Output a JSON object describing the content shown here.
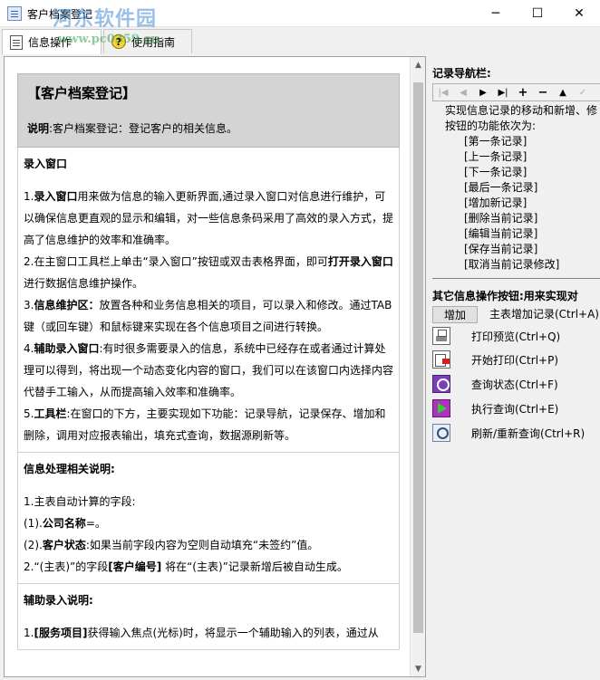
{
  "window": {
    "title": "客户档案登记",
    "watermark": "河东软件园",
    "watermark_url": "www.pc0359.cn",
    "controls": {
      "minimize": "─",
      "maximize": "☐",
      "close": "✕"
    }
  },
  "tabs": [
    {
      "label": "信息操作",
      "icon": "document-icon",
      "active": true
    },
    {
      "label": "使用指南",
      "icon": "help-icon",
      "active": false
    }
  ],
  "doc": {
    "title": "【客户档案登记】",
    "desc_bold": "说明",
    "desc_text": ":客户档案登记：登记客户的相关信息。",
    "sections": [
      {
        "heading": "录入窗口",
        "paras": [
          {
            "pre": "1.",
            "bold": "录入窗口",
            "text": "用来做为信息的输入更新界面,通过录入窗口对信息进行维护，可以确保信息更直观的显示和编辑，对一些信息条码采用了高效的录入方式，提高了信息维护的效率和准确率。"
          },
          {
            "pre": "2.",
            "bold": "",
            "text": "在主窗口工具栏上单击“录入窗口”按钮或双击表格界面，即可",
            "bold2": "打开录入窗口",
            "text2": "进行数据信息维护操作。"
          },
          {
            "pre": "3.",
            "bold": "信息维护区：",
            "text": "放置各种和业务信息相关的项目，可以录入和修改。通过TAB键（或回车键）和鼠标键来实现在各个信息项目之间进行转换。"
          },
          {
            "pre": "4.",
            "bold": "辅助录入窗口",
            "text": ":有时很多需要录入的信息，系统中已经存在或者通过计算处理可以得到，将出现一个动态变化内容的窗口，我们可以在该窗口内选择内容代替手工输入，从而提高输入效率和准确率。"
          },
          {
            "pre": "5.",
            "bold": "工具栏",
            "text": ":在窗口的下方，主要实现如下功能：记录导航，记录保存、增加和删除，调用对应报表输出，填充式查询，数据源刷新等。"
          }
        ]
      },
      {
        "heading": "信息处理相关说明:",
        "paras": [
          {
            "pre": "",
            "bold": "",
            "text": "1.主表自动计算的字段:"
          },
          {
            "pre": "(1).",
            "bold": "公司名称",
            "text": "=。"
          },
          {
            "pre": "(2).",
            "bold": "客户状态",
            "text": ":如果当前字段内容为空则自动填充“未签约”值。"
          },
          {
            "pre": "2.",
            "bold": "",
            "text": "“(主表)”的字段",
            "bold2": "[客户编号]",
            "text2": " 将在“(主表)”记录新增后被自动生成。"
          }
        ]
      },
      {
        "heading": "辅助录入说明:",
        "paras": [
          {
            "pre": "1.",
            "bold": "[服务项目]",
            "text": "获得输入焦点(光标)时，将显示一个辅助输入的列表，通过从"
          }
        ]
      }
    ]
  },
  "nav": {
    "title": "记录导航栏:",
    "buttons": [
      {
        "name": "first-record-button",
        "glyph": "|◀",
        "enabled": false
      },
      {
        "name": "prev-record-button",
        "glyph": "◀",
        "enabled": false
      },
      {
        "name": "next-record-button",
        "glyph": "▶",
        "enabled": true
      },
      {
        "name": "last-record-button",
        "glyph": "▶|",
        "enabled": true
      },
      {
        "name": "add-record-button",
        "glyph": "+",
        "enabled": true
      },
      {
        "name": "delete-record-button",
        "glyph": "−",
        "enabled": true
      },
      {
        "name": "edit-record-button",
        "glyph": "▲",
        "enabled": true
      },
      {
        "name": "save-record-button",
        "glyph": "✓",
        "enabled": false
      }
    ],
    "desc1": "实现信息记录的移动和新增、修",
    "desc2": "按钮的功能依次为:",
    "items": [
      "[第一条记录]",
      "[上一条记录]",
      "[下一条记录]",
      "[最后一条记录]",
      "[增加新记录]",
      "[删除当前记录]",
      "[编辑当前记录]",
      "[保存当前记录]",
      "[取消当前记录修改]"
    ]
  },
  "other": {
    "title": "其它信息操作按钮:用来实现对",
    "add_label": "增加",
    "add_desc": "主表增加记录(Ctrl+A)",
    "ops": [
      {
        "icon": "print-preview-icon",
        "label": "打印预览(Ctrl+Q)"
      },
      {
        "icon": "start-print-icon",
        "label": "开始打印(Ctrl+P)"
      },
      {
        "icon": "query-status-icon",
        "label": "查询状态(Ctrl+F)"
      },
      {
        "icon": "execute-query-icon",
        "label": "执行查询(Ctrl+E)"
      },
      {
        "icon": "refresh-icon",
        "label": "刷新/重新查询(Ctrl+R)"
      }
    ]
  }
}
